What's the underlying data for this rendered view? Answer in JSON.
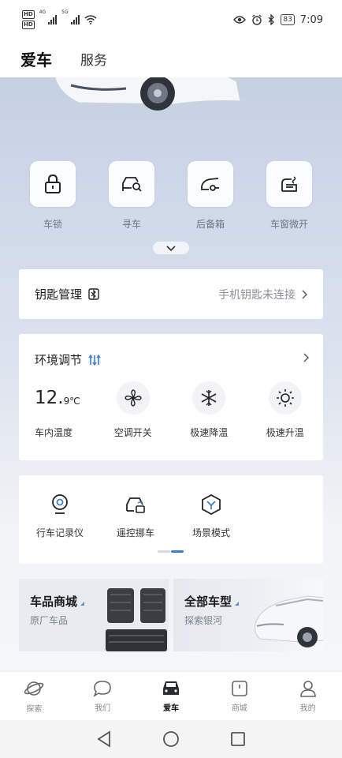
{
  "status_bar": {
    "hd_badges": [
      "HD",
      "HD"
    ],
    "net_labels": [
      "4G",
      "5G"
    ],
    "battery": "83",
    "time": "7:09",
    "icons": [
      "eye-icon",
      "alarm-icon",
      "bluetooth-icon",
      "battery-icon"
    ]
  },
  "header": {
    "tabs": [
      {
        "label": "爱车",
        "active": true
      },
      {
        "label": "服务",
        "active": false
      }
    ]
  },
  "quick_actions": [
    {
      "label": "车锁",
      "icon": "lock-icon"
    },
    {
      "label": "寻车",
      "icon": "find-car-icon"
    },
    {
      "label": "后备箱",
      "icon": "trunk-icon"
    },
    {
      "label": "车窗微开",
      "icon": "window-icon"
    }
  ],
  "key_card": {
    "title": "钥匙管理",
    "status": "手机钥匙未连接"
  },
  "env_card": {
    "title": "环境调节",
    "temp_value": "12.",
    "temp_unit": "9℃",
    "items": [
      {
        "label": "车内温度"
      },
      {
        "label": "空调开关",
        "icon": "fan-icon"
      },
      {
        "label": "极速降温",
        "icon": "snowflake-icon"
      },
      {
        "label": "极速升温",
        "icon": "sun-icon"
      }
    ]
  },
  "function_card": {
    "items": [
      {
        "label": "行车记录仪",
        "icon": "dashcam-icon"
      },
      {
        "label": "遥控挪车",
        "icon": "remote-move-icon"
      },
      {
        "label": "场景模式",
        "icon": "scene-mode-icon"
      }
    ],
    "page_index": 2,
    "page_count": 2
  },
  "promos": [
    {
      "title": "车品商城",
      "subtitle": "原厂车品"
    },
    {
      "title": "全部车型",
      "subtitle": "探索银河"
    }
  ],
  "bottom_nav": [
    {
      "label": "探索",
      "icon": "planet-icon",
      "active": false
    },
    {
      "label": "我们",
      "icon": "chat-icon",
      "active": false
    },
    {
      "label": "爱车",
      "icon": "car-icon",
      "active": true
    },
    {
      "label": "商城",
      "icon": "mall-icon",
      "active": false
    },
    {
      "label": "我的",
      "icon": "profile-icon",
      "active": false
    }
  ],
  "colors": {
    "accent_blue": "#3a7bd5",
    "page_indicator_active": "#3a7bd5",
    "page_indicator_inactive": "#d6dbe2"
  }
}
